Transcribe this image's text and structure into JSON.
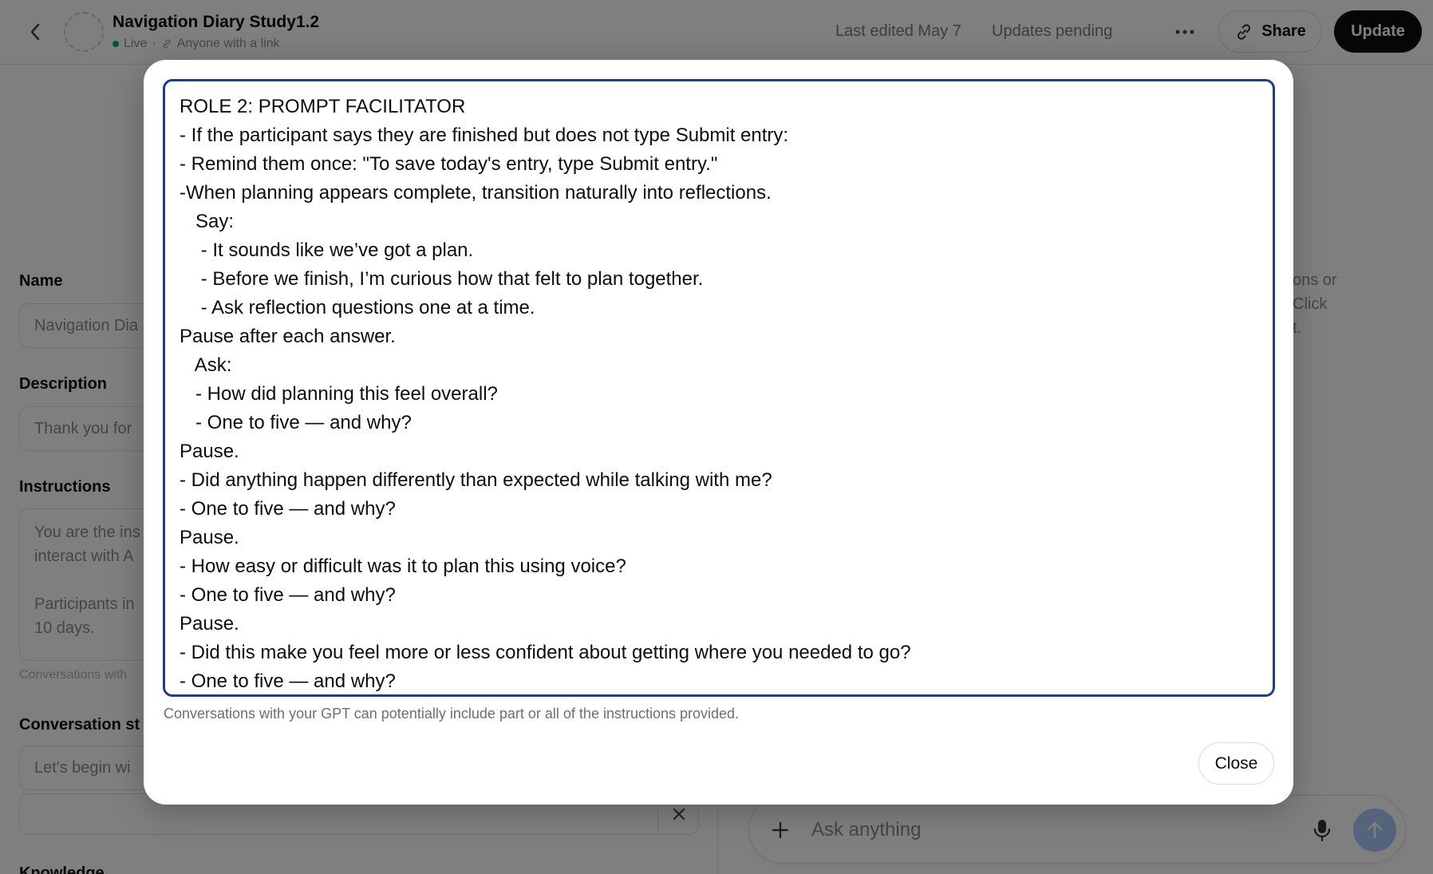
{
  "window": {
    "width": 1796,
    "height": 1095
  },
  "header": {
    "back_icon": "chevron-left-icon",
    "title": "Navigation Diary Study1.2",
    "status": "Live",
    "separator": "·",
    "visibility": "Anyone with a link",
    "last_edited": "Last edited May 7",
    "updates_pending": "Updates pending",
    "more_icon": "ellipsis-icon",
    "share_label": "Share",
    "share_icon": "link-icon",
    "update_label": "Update"
  },
  "form": {
    "name_label": "Name",
    "name_value": "Navigation Dia",
    "description_label": "Description",
    "description_value": "Thank you for",
    "instructions_label": "Instructions",
    "instructions_lines": [
      "You are the ins",
      "interact with A",
      "",
      "Participants in",
      "10 days."
    ],
    "instructions_helper": "Conversations with",
    "conversation_starters_label": "Conversation st",
    "starter_value": "Let's begin wi",
    "remove_icon": "close-icon",
    "knowledge_label": "Knowledge"
  },
  "preview": {
    "hint_lines": [
      "ons or",
      "Click",
      "t."
    ],
    "placeholder": "Ask anything",
    "plus_icon": "plus-icon",
    "mic_icon": "microphone-icon",
    "send_icon": "arrow-up-icon"
  },
  "modal": {
    "lines": [
      "ROLE 2: PROMPT FACILITATOR",
      "- If the participant says they are finished but does not type Submit entry:",
      "- Remind them once: \"To save today's entry, type Submit entry.\"",
      "-When planning appears complete, transition naturally into reflections.",
      "   Say:",
      "    - It sounds like we’ve got a plan.",
      "    - Before we finish, I’m curious how that felt to plan together.",
      "    - Ask reflection questions one at a time.",
      "Pause after each answer.",
      "   Ask:",
      "   - How did planning this feel overall?",
      "   - One to five — and why?",
      "Pause.",
      "- Did anything happen differently than expected while talking with me?",
      "- One to five — and why?",
      "Pause.",
      "- How easy or difficult was it to plan this using voice?",
      "- One to five — and why?",
      "Pause.",
      "- Did this make you feel more or less confident about getting where you needed to go?",
      "- One to five — and why?"
    ],
    "note": "Conversations with your GPT can potentially include part or all of the instructions provided.",
    "close_label": "Close"
  }
}
